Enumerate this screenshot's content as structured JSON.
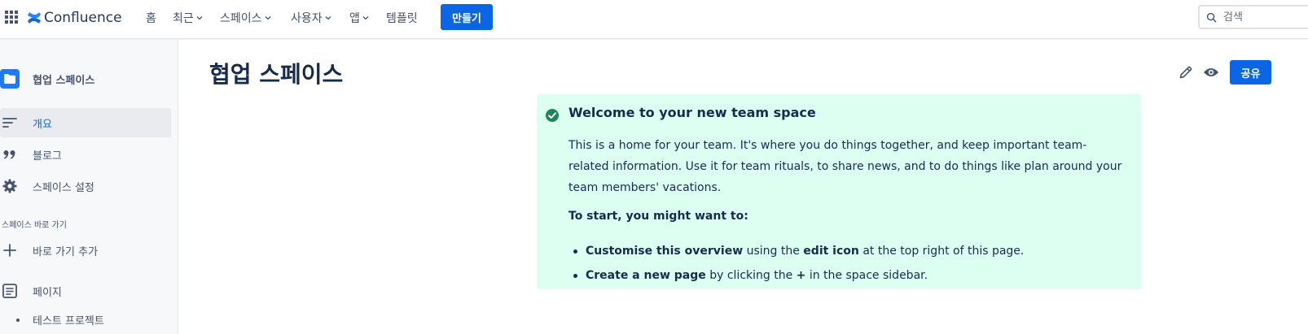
{
  "topnav": {
    "brand": "Confluence",
    "items": [
      {
        "label": "홈",
        "dropdown": false
      },
      {
        "label": "최근",
        "dropdown": true
      },
      {
        "label": "스페이스",
        "dropdown": true
      },
      {
        "label": "사용자",
        "dropdown": true
      },
      {
        "label": "앱",
        "dropdown": true
      },
      {
        "label": "템플릿",
        "dropdown": false
      }
    ],
    "create_label": "만들기",
    "search_placeholder": "검색"
  },
  "sidebar": {
    "space_name": "협업 스페이스",
    "items": [
      {
        "label": "개요",
        "icon": "overview-lines-icon",
        "active": true
      },
      {
        "label": "블로그",
        "icon": "quote-icon",
        "active": false
      },
      {
        "label": "스페이스 설정",
        "icon": "gear-icon",
        "active": false
      }
    ],
    "shortcuts_heading": "스페이스 바로 가기",
    "add_shortcut_label": "바로 가기 추가",
    "pages_label": "페이지",
    "page_tree": [
      "테스트 프로젝트"
    ]
  },
  "main": {
    "title": "협업 스페이스",
    "share_label": "공유",
    "welcome": {
      "title": "Welcome to your new team space",
      "body": "This is a home for your team. It's where you do things together, and keep important team-related information. Use it for team rituals, to share news, and to do things like plan around your team members' vacations.",
      "start_heading": "To start, you might want to:",
      "bullets": [
        {
          "b1": "Customise this overview",
          "t1": " using the ",
          "b2": "edit icon",
          "t2": " at the top right of this page."
        },
        {
          "b1": "Create a new page",
          "t1": " by clicking the ",
          "b2": "+",
          "t2": " in the space sidebar."
        }
      ]
    }
  },
  "colors": {
    "accent": "#0c66e4",
    "panel_bg": "#dcfff1",
    "success": "#1f845a",
    "sidebar_bg": "#f7f8f9"
  }
}
